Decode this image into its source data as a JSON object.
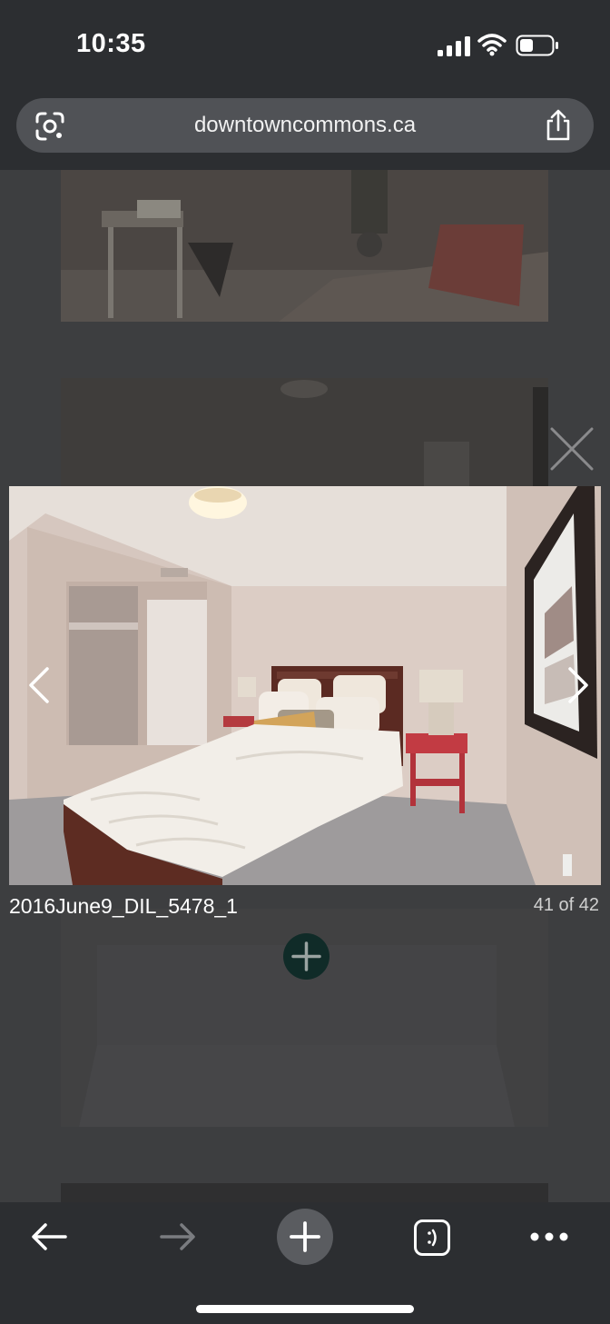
{
  "status_bar": {
    "time": "10:35"
  },
  "browser": {
    "url": "downtowncommons.ca"
  },
  "lightbox": {
    "caption": "2016June9_DIL_5478_1",
    "counter": "41 of 42"
  },
  "icons": {
    "lens": "google-lens-icon",
    "share": "share-icon",
    "close": "close-icon",
    "prev": "chevron-left-icon",
    "next": "chevron-right-icon",
    "add": "plus-icon",
    "back": "arrow-left-icon",
    "forward": "arrow-right-icon",
    "tabs": "tab-switcher-icon",
    "menu": "more-horizontal-icon"
  },
  "colors": {
    "chrome_bg": "#2c2e31",
    "url_pill": "#505256",
    "fab": "#102b28"
  }
}
